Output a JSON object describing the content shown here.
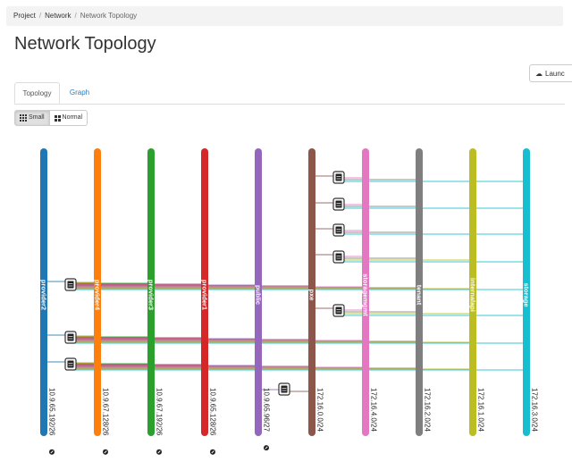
{
  "breadcrumb": {
    "items": [
      "Project",
      "Network"
    ],
    "current": "Network Topology"
  },
  "page": {
    "title": "Network Topology"
  },
  "actions": {
    "launch_label": "Launc"
  },
  "tabs": [
    {
      "label": "Topology",
      "active": true
    },
    {
      "label": "Graph",
      "active": false
    }
  ],
  "view_toggle": {
    "small_label": "Small",
    "normal_label": "Normal",
    "selected": "Small"
  },
  "networks": [
    {
      "name": "provider2",
      "cidr": "10.9.65.192/26",
      "color": "#1f77b4"
    },
    {
      "name": "provider4",
      "cidr": "10.9.67.128/26",
      "color": "#ff7f0e"
    },
    {
      "name": "provider3",
      "cidr": "10.9.67.192/26",
      "color": "#2ca02c"
    },
    {
      "name": "provider1",
      "cidr": "10.9.65.128/26",
      "color": "#d62728"
    },
    {
      "name": "public",
      "cidr": "10.9.65.96/27",
      "color": "#9467bd"
    },
    {
      "name": "pxe",
      "cidr": "172.16.0.0/24",
      "color": "#8c564b"
    },
    {
      "name": "storagemgmt",
      "cidr": "172.16.4.0/24",
      "color": "#e377c2"
    },
    {
      "name": "tenant",
      "cidr": "172.16.2.0/24",
      "color": "#7f7f7f"
    },
    {
      "name": "internalapi",
      "cidr": "172.16.1.0/24",
      "color": "#bcbd22"
    },
    {
      "name": "storage",
      "cidr": "172.16.3.0/24",
      "color": "#17becf"
    }
  ],
  "colors": {
    "link_blue": "#2a7ab8",
    "breadcrumb_bg": "#f3f3f3"
  },
  "icons": {
    "launch": "cloud-upload-icon",
    "small": "grid-small-icon",
    "normal": "grid-large-icon",
    "server": "server-icon",
    "external": "external-link-icon"
  }
}
